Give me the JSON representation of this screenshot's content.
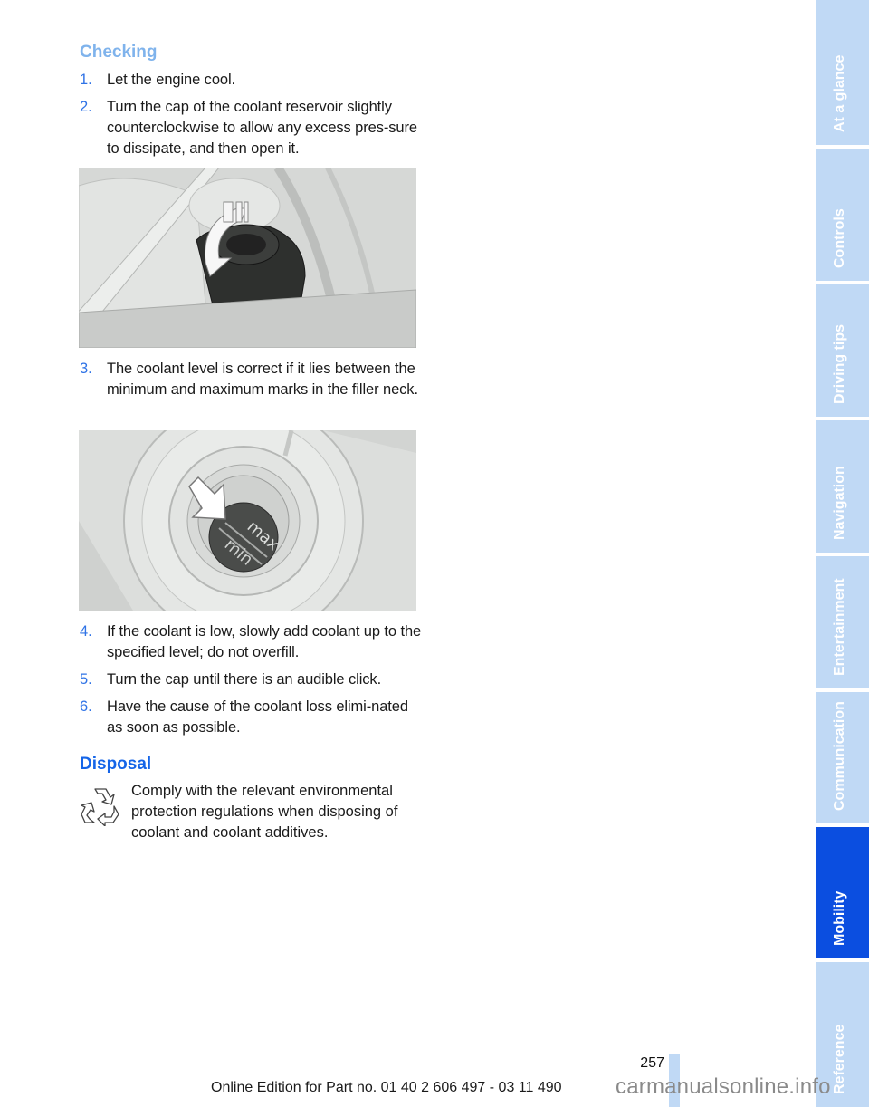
{
  "sections": {
    "checking": {
      "heading": "Checking",
      "steps_a": [
        {
          "num": "1.",
          "text": "Let the engine cool."
        },
        {
          "num": "2.",
          "text": "Turn the cap of the coolant reservoir slightly counterclockwise to allow any excess pres-sure to dissipate, and then open it."
        }
      ],
      "figure1_alt": "Coolant reservoir cap with turning arrow",
      "steps_b": [
        {
          "num": "3.",
          "text": "The coolant level is correct if it lies between the minimum and maximum marks in the filler neck."
        }
      ],
      "figure2_alt": "Filler neck with min and max marks",
      "figure2_labels": {
        "max": "max",
        "min": "min"
      },
      "steps_c": [
        {
          "num": "4.",
          "text": "If the coolant is low, slowly add coolant up to the specified level; do not overfill."
        },
        {
          "num": "5.",
          "text": "Turn the cap until there is an audible click."
        },
        {
          "num": "6.",
          "text": "Have the cause of the coolant loss elimi-nated as soon as possible."
        }
      ]
    },
    "disposal": {
      "heading": "Disposal",
      "icon": "recycle-icon",
      "text": "Comply with the relevant environmental protection regulations when disposing of coolant and coolant additives."
    }
  },
  "side_tabs": [
    {
      "label": "At a glance",
      "active": false
    },
    {
      "label": "Controls",
      "active": false
    },
    {
      "label": "Driving tips",
      "active": false
    },
    {
      "label": "Navigation",
      "active": false
    },
    {
      "label": "Entertainment",
      "active": false
    },
    {
      "label": "Communication",
      "active": false
    },
    {
      "label": "Mobility",
      "active": true
    },
    {
      "label": "Reference",
      "active": false
    }
  ],
  "footer": {
    "page_number": "257",
    "edition": "Online Edition for Part no. 01 40 2 606 497 - 03 11 490",
    "watermark": "carmanualsonline.info"
  },
  "colors": {
    "heading_light": "#7fb3ec",
    "heading_dark": "#1565e8",
    "tab_inactive": "#c0d9f5",
    "tab_active": "#0b4ee0"
  }
}
